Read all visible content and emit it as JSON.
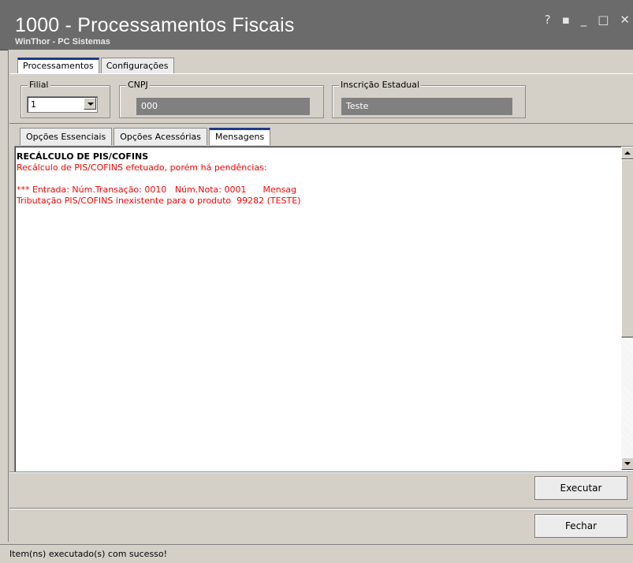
{
  "window": {
    "title": "1000 - Processamentos Fiscais",
    "subtitle": "WinThor - PC Sistemas",
    "buttons": [
      "?",
      "▪",
      "_",
      "□",
      "✕"
    ]
  },
  "top_tabs": [
    {
      "label": "Processamentos",
      "active": true
    },
    {
      "label": "Configurações",
      "active": false
    }
  ],
  "fields": {
    "filial": {
      "label": "Filial",
      "value": "1"
    },
    "cnpj": {
      "label": "CNPJ",
      "value": "000"
    },
    "inscricao": {
      "label": "Inscrição Estadual",
      "value": "Teste"
    }
  },
  "sub_tabs": [
    {
      "label": "Opções Essenciais",
      "active": false
    },
    {
      "label": "Opções Acessórias",
      "active": false
    },
    {
      "label": "Mensagens",
      "active": true
    }
  ],
  "messages": {
    "heading": "RECÁLCULO DE PIS/COFINS",
    "line1": "Recálculo de PIS/COFINS efetuado, porém há pendências:",
    "line2": "*** Entrada: Núm.Transação: 0010   Núm.Nota: 0001      Mensag",
    "line3": "Tributação PIS/COFINS inexistente para o produto  99282 (TESTE)"
  },
  "actions": {
    "executar": "Executar",
    "fechar": "Fechar"
  },
  "status": "Item(ns) executado(s) com sucesso!",
  "colors": {
    "titlebar": "#6b6b6b",
    "message_red": "#ff0000",
    "tab_accent": "#1f3a8a"
  }
}
